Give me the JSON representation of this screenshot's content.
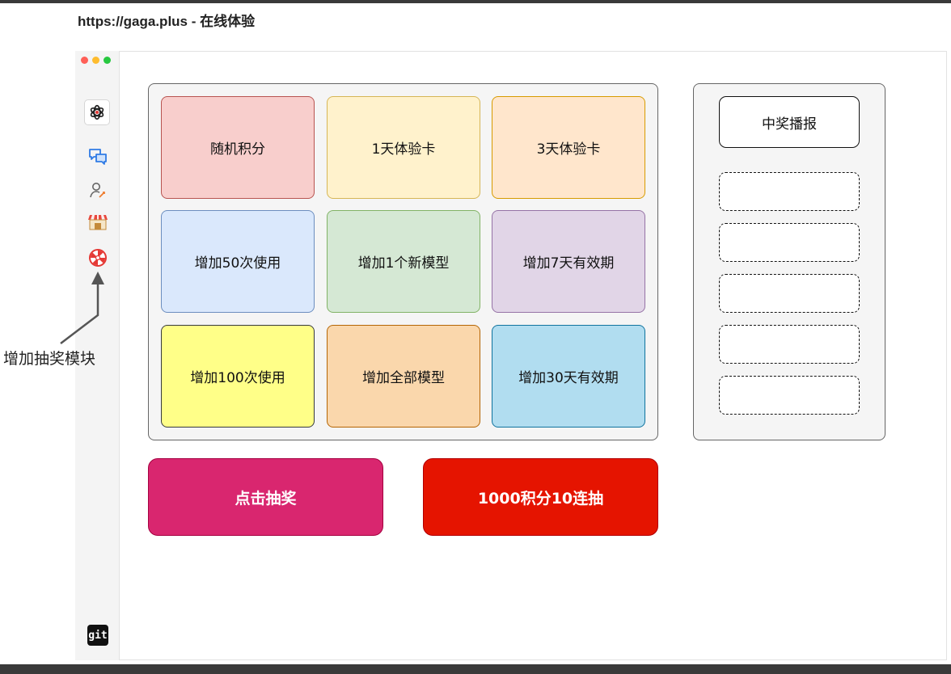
{
  "page": {
    "title": "https://gaga.plus - 在线体验"
  },
  "window": {
    "traffic_lights": {
      "close": "#ff5f57",
      "minimize": "#febc2e",
      "maximize": "#28c840"
    }
  },
  "sidebar": {
    "items": [
      {
        "icon": "openai-logo-icon"
      },
      {
        "icon": "chat-icon"
      },
      {
        "icon": "user-icon"
      },
      {
        "icon": "shop-icon"
      },
      {
        "icon": "lottery-wheel-icon"
      }
    ],
    "footer": {
      "icon": "git-icon",
      "label": "git"
    }
  },
  "prizes": [
    {
      "label": "随机积分",
      "bg": "#f8cecc",
      "border": "#b85450"
    },
    {
      "label": "1天体验卡",
      "bg": "#fff2cc",
      "border": "#d6b656"
    },
    {
      "label": "3天体验卡",
      "bg": "#ffe6cc",
      "border": "#d79b00"
    },
    {
      "label": "增加50次使用",
      "bg": "#dae8fc",
      "border": "#6c8ebf"
    },
    {
      "label": "增加1个新模型",
      "bg": "#d5e8d4",
      "border": "#82b366"
    },
    {
      "label": "增加7天有效期",
      "bg": "#e1d5e7",
      "border": "#9673a6"
    },
    {
      "label": "增加100次使用",
      "bg": "#ffff88",
      "border": "#36393d"
    },
    {
      "label": "增加全部模型",
      "bg": "#fad7ac",
      "border": "#b46504"
    },
    {
      "label": "增加30天有效期",
      "bg": "#b1ddf0",
      "border": "#10739e"
    }
  ],
  "broadcast": {
    "title": "中奖播报",
    "slot_count": 5
  },
  "buttons": {
    "draw": {
      "label": "点击抽奖",
      "color": "#d9266f"
    },
    "ten_draw": {
      "label": "1000积分10连抽",
      "color": "#e51400"
    }
  },
  "annotation": {
    "text": "增加抽奖模块"
  }
}
